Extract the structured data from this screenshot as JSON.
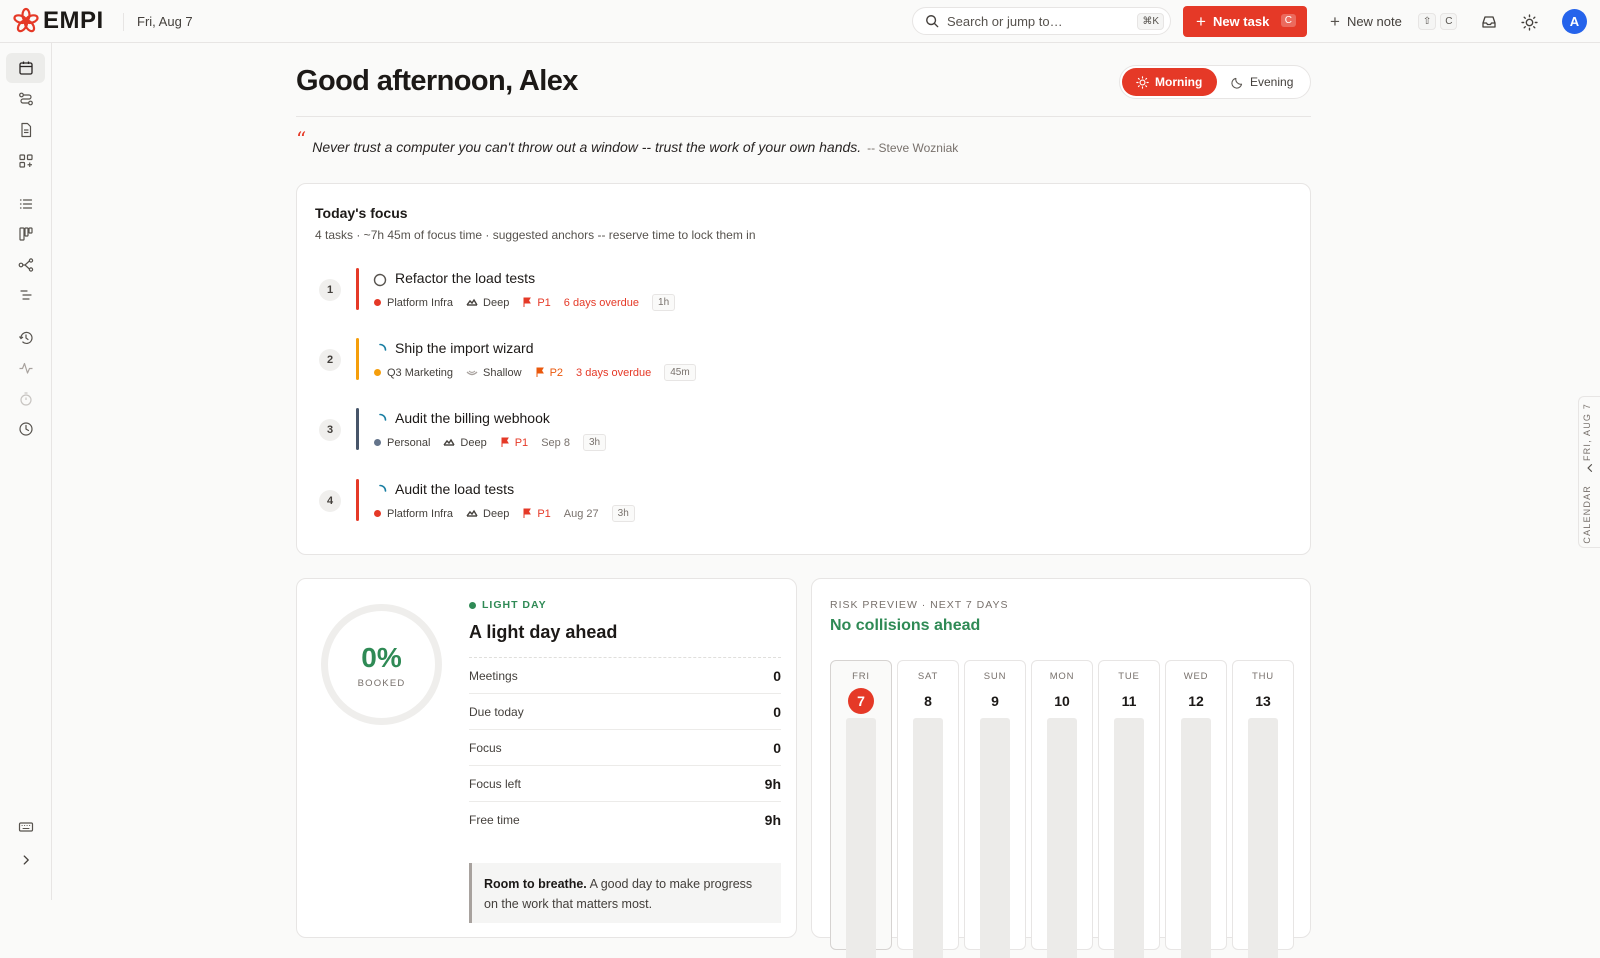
{
  "app": {
    "name": "EMPI",
    "date": "Fri, Aug 7"
  },
  "topbar": {
    "search_placeholder": "Search or jump to…",
    "search_shortcut": "⌘K",
    "new_task_label": "New task",
    "new_task_shortcut": "C",
    "new_note_label": "New note",
    "new_note_shortcut_mod": "⇧",
    "new_note_shortcut_key": "C",
    "avatar_initial": "A",
    "accent_color": "#e53927"
  },
  "sidebar": {
    "items": [
      {
        "icon": "calendar-icon",
        "active": true
      },
      {
        "icon": "route-icon"
      },
      {
        "icon": "document-icon"
      },
      {
        "icon": "grid-plus-icon"
      },
      {
        "icon": "list-icon"
      },
      {
        "icon": "kanban-icon"
      },
      {
        "icon": "branch-icon"
      },
      {
        "icon": "indent-list-icon"
      },
      {
        "icon": "history-icon"
      },
      {
        "icon": "activity-icon"
      },
      {
        "icon": "timer-icon"
      },
      {
        "icon": "clock-icon"
      },
      {
        "icon": "keyboard-icon"
      },
      {
        "icon": "expand-chevron-icon"
      }
    ]
  },
  "calendar_tab": {
    "date": "FRI, AUG 7",
    "label": "CALENDAR"
  },
  "header": {
    "greeting": "Good afternoon, Alex",
    "mode_morning": "Morning",
    "mode_evening": "Evening",
    "active_mode": "Morning"
  },
  "quote": {
    "text": "Never trust a computer you can't throw out a window -- trust the work of your own hands.",
    "author": "-- Steve Wozniak"
  },
  "focus": {
    "title": "Today's focus",
    "subtitle": "4 tasks · ~7h 45m of focus time · suggested anchors -- reserve time to lock them in",
    "tasks": [
      {
        "num": "1",
        "title": "Refactor the load tests",
        "status": "not-started",
        "project": "Platform Infra",
        "project_color": "#e53927",
        "depth": "Deep",
        "priority": "P1",
        "due": "6 days overdue",
        "due_overdue": true,
        "estimate": "1h"
      },
      {
        "num": "2",
        "title": "Ship the import wizard",
        "status": "in-progress",
        "project": "Q3 Marketing",
        "project_color": "#f59e0b",
        "depth": "Shallow",
        "priority": "P2",
        "due": "3 days overdue",
        "due_overdue": true,
        "estimate": "45m"
      },
      {
        "num": "3",
        "title": "Audit the billing webhook",
        "status": "in-progress",
        "project": "Personal",
        "project_color": "#64748b",
        "depth": "Deep",
        "priority": "P1",
        "due": "Sep 8",
        "due_overdue": false,
        "estimate": "3h"
      },
      {
        "num": "4",
        "title": "Audit the load tests",
        "status": "in-progress",
        "project": "Platform Infra",
        "project_color": "#e53927",
        "depth": "Deep",
        "priority": "P1",
        "due": "Aug 27",
        "due_overdue": false,
        "estimate": "3h"
      }
    ]
  },
  "day": {
    "booked_pct": "0%",
    "booked_label": "BOOKED",
    "tag": "LIGHT DAY",
    "title": "A light day ahead",
    "stats": [
      {
        "label": "Meetings",
        "value": "0"
      },
      {
        "label": "Due today",
        "value": "0"
      },
      {
        "label": "Focus",
        "value": "0"
      },
      {
        "label": "Focus left",
        "value": "9h"
      },
      {
        "label": "Free time",
        "value": "9h"
      }
    ],
    "note_bold": "Room to breathe.",
    "note_text": " A good day to make progress on the work that matters most."
  },
  "risk": {
    "label": "RISK PREVIEW · NEXT 7 DAYS",
    "title": "No collisions ahead",
    "days": [
      {
        "dow": "FRI",
        "num": "7",
        "today": true
      },
      {
        "dow": "SAT",
        "num": "8"
      },
      {
        "dow": "SUN",
        "num": "9"
      },
      {
        "dow": "MON",
        "num": "10"
      },
      {
        "dow": "TUE",
        "num": "11"
      },
      {
        "dow": "WED",
        "num": "12"
      },
      {
        "dow": "THU",
        "num": "13"
      }
    ]
  }
}
